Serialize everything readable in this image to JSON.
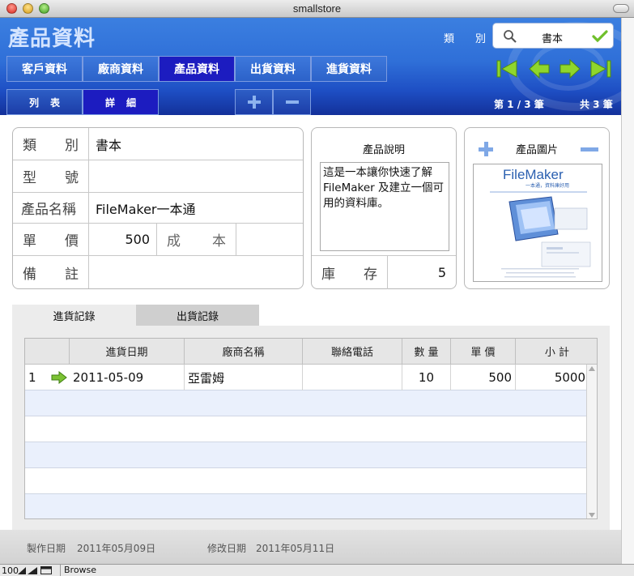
{
  "window": {
    "title": "smallstore"
  },
  "header": {
    "title": "產品資料",
    "category_label_chars": [
      "類",
      "別"
    ],
    "search_value": "書本"
  },
  "nav_tabs": [
    {
      "label": "客戶資料",
      "active": false
    },
    {
      "label": "廠商資料",
      "active": false
    },
    {
      "label": "產品資料",
      "active": true
    },
    {
      "label": "出貨資料",
      "active": false
    },
    {
      "label": "進貨資料",
      "active": false
    }
  ],
  "view_tabs": [
    {
      "label": "列表",
      "active": false
    },
    {
      "label": "詳細",
      "active": true
    }
  ],
  "record": {
    "position": "第 1 / 3 筆",
    "total": "共 3 筆"
  },
  "form": {
    "category": {
      "label_chars": [
        "類",
        "別"
      ],
      "value": "書本"
    },
    "model": {
      "label_chars": [
        "型",
        "號"
      ],
      "value": ""
    },
    "name": {
      "label": "產品名稱",
      "value": "FileMaker一本通"
    },
    "price": {
      "label_chars": [
        "單",
        "價"
      ],
      "value": "500"
    },
    "cost": {
      "label_chars": [
        "成",
        "本"
      ],
      "value": ""
    },
    "note": {
      "label_chars": [
        "備",
        "註"
      ],
      "value": ""
    }
  },
  "description": {
    "title": "產品說明",
    "text": "這是一本讓你快速了解 FileMaker 及建立一個可用的資料庫。"
  },
  "stock": {
    "label_chars": [
      "庫",
      "存"
    ],
    "value": "5"
  },
  "image_panel": {
    "title": "產品圖片",
    "book_title": "FileMaker",
    "book_subtitle": "一本通，資料庫好用"
  },
  "portal_tabs": [
    {
      "label": "進貨記錄",
      "active": true
    },
    {
      "label": "出貨記錄",
      "active": false
    }
  ],
  "portal": {
    "headers": [
      "進貨日期",
      "廠商名稱",
      "聯絡電話",
      "數 量",
      "單 價",
      "小 計"
    ],
    "rows": [
      {
        "index": "1",
        "date": "2011-05-09",
        "vendor": "亞雷姆",
        "phone": "",
        "qty": "10",
        "price": "500",
        "subtotal": "5000"
      }
    ],
    "empty_rows": 5
  },
  "footer": {
    "created_label": "製作日期",
    "created_value": "2011年05月09日",
    "modified_label": "修改日期",
    "modified_value": "2011年05月11日"
  },
  "statusbar": {
    "zoom": "100",
    "mode": "Browse"
  },
  "colors": {
    "header_blue": "#2f6fd8",
    "active_tab": "#1c1cc0",
    "nav_arrow_green": "#8fd62c",
    "row_alt": "#eaf0fc"
  }
}
